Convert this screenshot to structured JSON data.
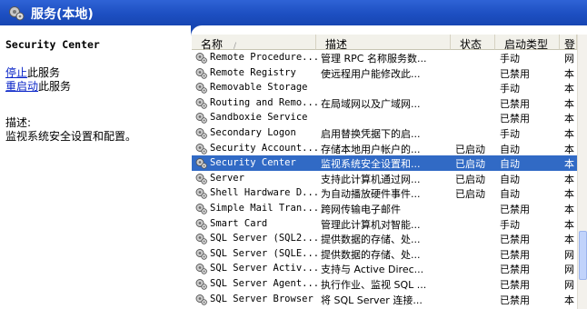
{
  "window": {
    "title": "服务(本地)"
  },
  "left_pane": {
    "service_name": "Security Center",
    "actions": [
      {
        "link": "停止",
        "suffix": "此服务"
      },
      {
        "link": "重启动",
        "suffix": "此服务"
      }
    ],
    "description_label": "描述:",
    "description_text": "监视系统安全设置和配置。"
  },
  "table": {
    "columns": [
      "名称",
      "描述",
      "状态",
      "启动类型",
      "登"
    ],
    "sort_indicator": "/",
    "rows": [
      {
        "name": "Remote Procedure...",
        "desc": "管理 RPC 名称服务数...",
        "status": "",
        "startup": "手动",
        "logon": "网"
      },
      {
        "name": "Remote Registry",
        "desc": "使远程用户能修改此...",
        "status": "",
        "startup": "已禁用",
        "logon": "本"
      },
      {
        "name": "Removable Storage",
        "desc": "",
        "status": "",
        "startup": "手动",
        "logon": "本"
      },
      {
        "name": "Routing and Remo...",
        "desc": "在局域网以及广域网...",
        "status": "",
        "startup": "已禁用",
        "logon": "本"
      },
      {
        "name": "Sandboxie Service",
        "desc": "",
        "status": "",
        "startup": "已禁用",
        "logon": "本"
      },
      {
        "name": "Secondary Logon",
        "desc": "启用替换凭据下的启...",
        "status": "",
        "startup": "手动",
        "logon": "本"
      },
      {
        "name": "Security Account...",
        "desc": "存储本地用户帐户的...",
        "status": "已启动",
        "startup": "自动",
        "logon": "本"
      },
      {
        "name": "Security Center",
        "desc": "监视系统安全设置和...",
        "status": "已启动",
        "startup": "自动",
        "logon": "本"
      },
      {
        "name": "Server",
        "desc": "支持此计算机通过网...",
        "status": "已启动",
        "startup": "自动",
        "logon": "本"
      },
      {
        "name": "Shell Hardware D...",
        "desc": "为自动播放硬件事件...",
        "status": "已启动",
        "startup": "自动",
        "logon": "本"
      },
      {
        "name": "Simple Mail Tran...",
        "desc": "跨网传输电子邮件",
        "status": "",
        "startup": "已禁用",
        "logon": "本"
      },
      {
        "name": "Smart Card",
        "desc": "管理此计算机对智能...",
        "status": "",
        "startup": "手动",
        "logon": "本"
      },
      {
        "name": "SQL Server (SQL2...",
        "desc": "提供数据的存储、处...",
        "status": "",
        "startup": "已禁用",
        "logon": "本"
      },
      {
        "name": "SQL Server (SQLE...",
        "desc": "提供数据的存储、处...",
        "status": "",
        "startup": "已禁用",
        "logon": "网"
      },
      {
        "name": "SQL Server Activ...",
        "desc": "支持与 Active Direc...",
        "status": "",
        "startup": "已禁用",
        "logon": "网"
      },
      {
        "name": "SQL Server Agent...",
        "desc": "执行作业、监视 SQL ...",
        "status": "",
        "startup": "已禁用",
        "logon": "网"
      },
      {
        "name": "SQL Server Browser",
        "desc": "将 SQL Server 连接...",
        "status": "",
        "startup": "已禁用",
        "logon": "本"
      }
    ],
    "selected_row": 7
  },
  "colors": {
    "title_bar": "#1d4fc1",
    "selection": "#316ac5",
    "link": "#0a25c8"
  }
}
